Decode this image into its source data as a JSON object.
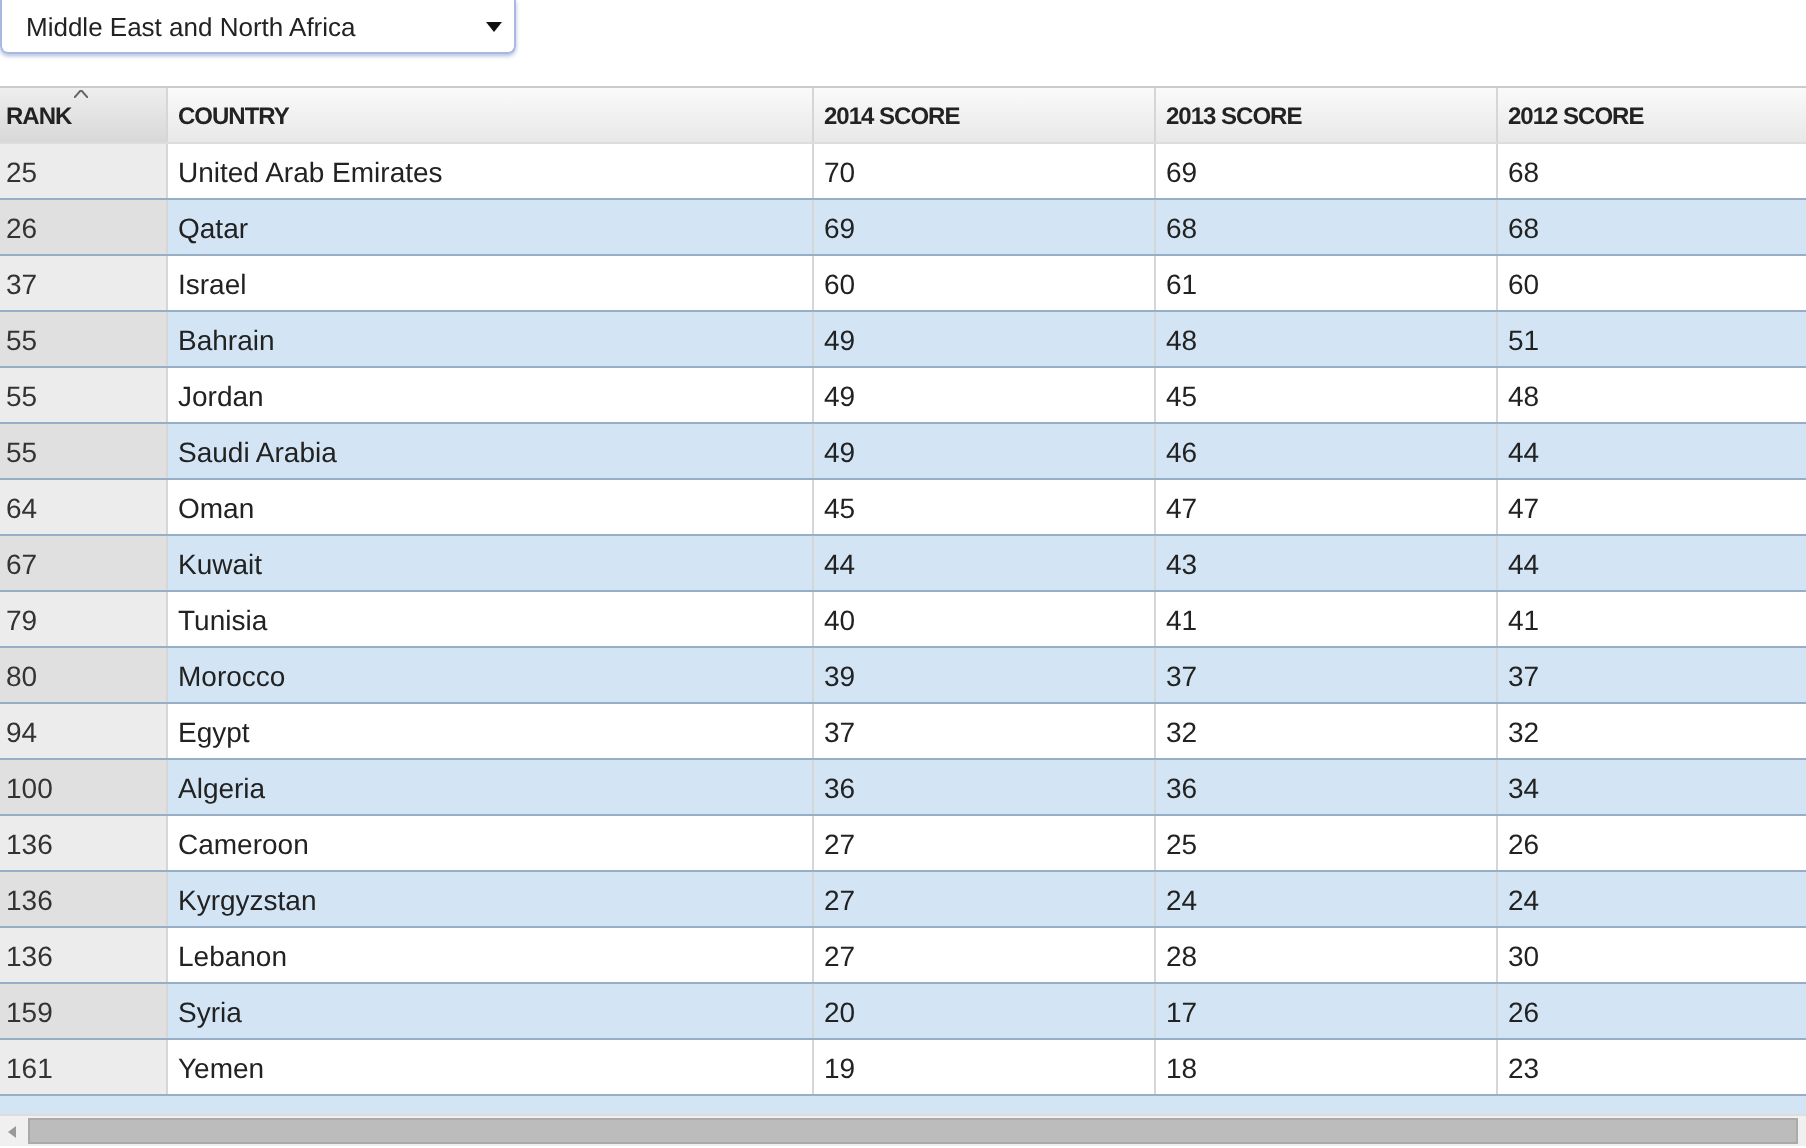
{
  "region_select": {
    "value": "Middle East and North Africa"
  },
  "table": {
    "columns": [
      {
        "label": "RANK",
        "sorted": true
      },
      {
        "label": "COUNTRY",
        "sorted": false
      },
      {
        "label": "2014 SCORE",
        "sorted": false
      },
      {
        "label": "2013 SCORE",
        "sorted": false
      },
      {
        "label": "2012 SCORE",
        "sorted": false
      }
    ],
    "rows": [
      [
        "25",
        "United Arab Emirates",
        "70",
        "69",
        "68"
      ],
      [
        "26",
        "Qatar",
        "69",
        "68",
        "68"
      ],
      [
        "37",
        "Israel",
        "60",
        "61",
        "60"
      ],
      [
        "55",
        "Bahrain",
        "49",
        "48",
        "51"
      ],
      [
        "55",
        "Jordan",
        "49",
        "45",
        "48"
      ],
      [
        "55",
        "Saudi Arabia",
        "49",
        "46",
        "44"
      ],
      [
        "64",
        "Oman",
        "45",
        "47",
        "47"
      ],
      [
        "67",
        "Kuwait",
        "44",
        "43",
        "44"
      ],
      [
        "79",
        "Tunisia",
        "40",
        "41",
        "41"
      ],
      [
        "80",
        "Morocco",
        "39",
        "37",
        "37"
      ],
      [
        "94",
        "Egypt",
        "37",
        "32",
        "32"
      ],
      [
        "100",
        "Algeria",
        "36",
        "36",
        "34"
      ],
      [
        "136",
        "Cameroon",
        "27",
        "25",
        "26"
      ],
      [
        "136",
        "Kyrgyzstan",
        "27",
        "24",
        "24"
      ],
      [
        "136",
        "Lebanon",
        "27",
        "28",
        "30"
      ],
      [
        "159",
        "Syria",
        "20",
        "17",
        "26"
      ],
      [
        "161",
        "Yemen",
        "19",
        "18",
        "23"
      ]
    ]
  }
}
